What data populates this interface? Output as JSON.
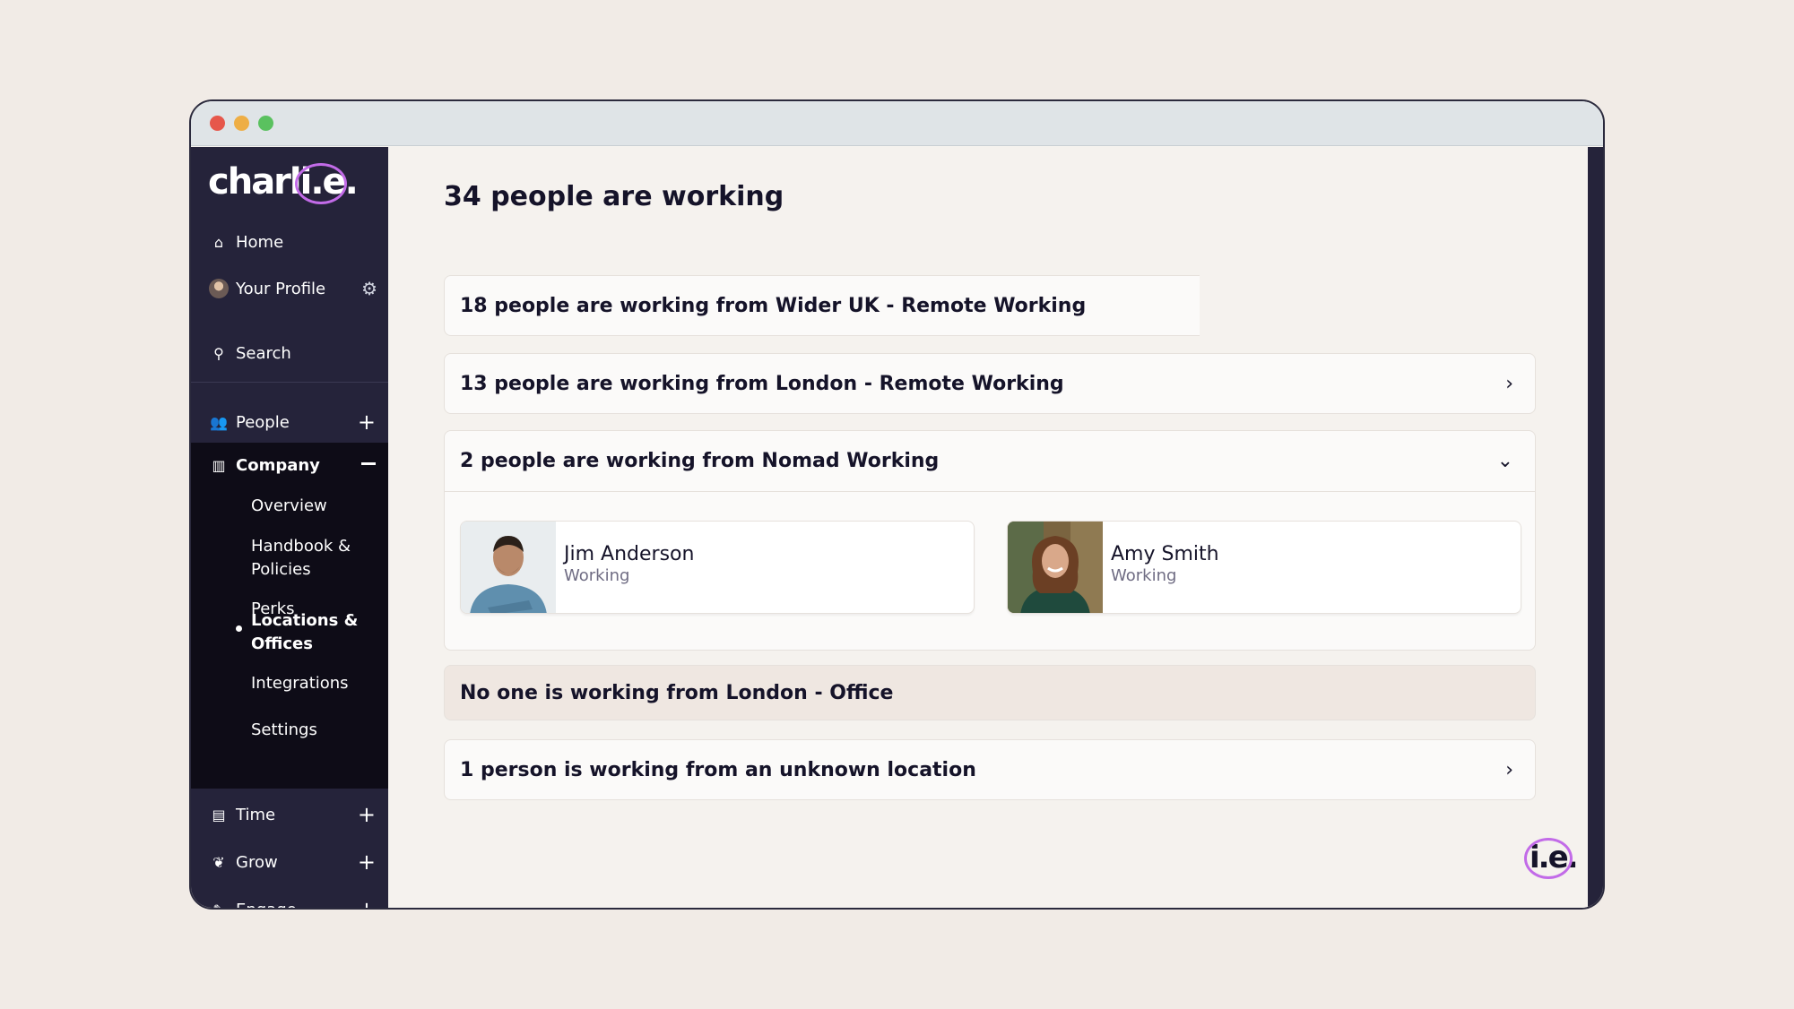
{
  "brand": {
    "logo_text": "charl",
    "logo_suffix": "i.e.",
    "accent": "#c26be8"
  },
  "sidebar": {
    "home": "Home",
    "profile": "Your Profile",
    "search": "Search",
    "people": "People",
    "company": "Company",
    "company_items": [
      "Overview",
      "Handbook &",
      "Policies",
      "Perks",
      "Locations &",
      "Offices",
      "Integrations",
      "Settings"
    ],
    "time": "Time",
    "grow": "Grow",
    "engage": "Engage"
  },
  "main": {
    "title": "34 people are working",
    "groups": [
      {
        "label": "18 people are working from Wider UK - Remote Working"
      },
      {
        "label": "13 people are working from London - Remote Working"
      },
      {
        "label": "2 people are working from Nomad Working"
      },
      {
        "label": "No one is working from London - Office"
      },
      {
        "label": "1 person is working from an unknown location"
      }
    ],
    "people": [
      {
        "name": "Jim Anderson",
        "status": "Working"
      },
      {
        "name": "Amy Smith",
        "status": "Working"
      }
    ]
  },
  "fab": {
    "label": "i.e."
  }
}
